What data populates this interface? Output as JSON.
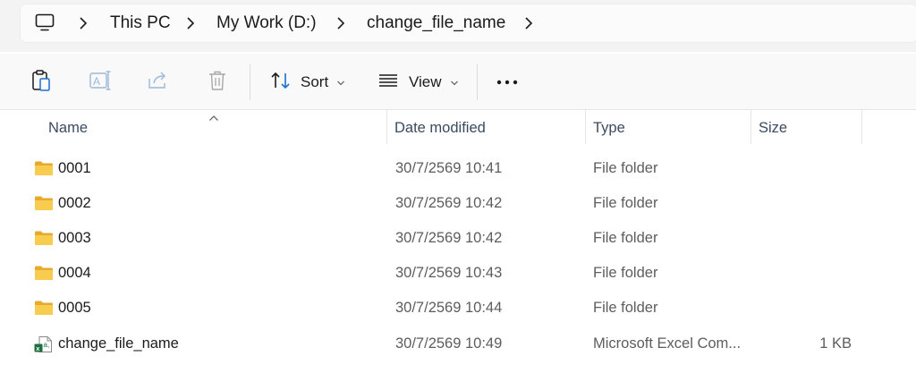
{
  "address_bar": {
    "root_icon": "computer-icon",
    "crumbs": [
      "This PC",
      "My Work (D:)",
      "change_file_name"
    ]
  },
  "toolbar": {
    "buttons": [
      "paste-icon",
      "rename-icon",
      "share-icon",
      "delete-icon"
    ],
    "sort_label": "Sort",
    "view_label": "View",
    "more_icon": "ellipsis-icon"
  },
  "columns": {
    "name": "Name",
    "date": "Date modified",
    "type": "Type",
    "size": "Size"
  },
  "files": [
    {
      "name": "0001",
      "date": "30/7/2569 10:41",
      "type": "File folder",
      "size": "",
      "icon": "folder-icon"
    },
    {
      "name": "0002",
      "date": "30/7/2569 10:42",
      "type": "File folder",
      "size": "",
      "icon": "folder-icon"
    },
    {
      "name": "0003",
      "date": "30/7/2569 10:42",
      "type": "File folder",
      "size": "",
      "icon": "folder-icon"
    },
    {
      "name": "0004",
      "date": "30/7/2569 10:43",
      "type": "File folder",
      "size": "",
      "icon": "folder-icon"
    },
    {
      "name": "0005",
      "date": "30/7/2569 10:44",
      "type": "File folder",
      "size": "",
      "icon": "folder-icon"
    },
    {
      "name": "change_file_name",
      "date": "30/7/2569 10:49",
      "type": "Microsoft Excel Com...",
      "size": "1 KB",
      "icon": "excel-csv-icon"
    }
  ],
  "colors": {
    "folder": "#f6c343",
    "excel": "#1d6f42",
    "header_text": "#3b4a5e",
    "disabled_icon": "#9bb8d6"
  }
}
